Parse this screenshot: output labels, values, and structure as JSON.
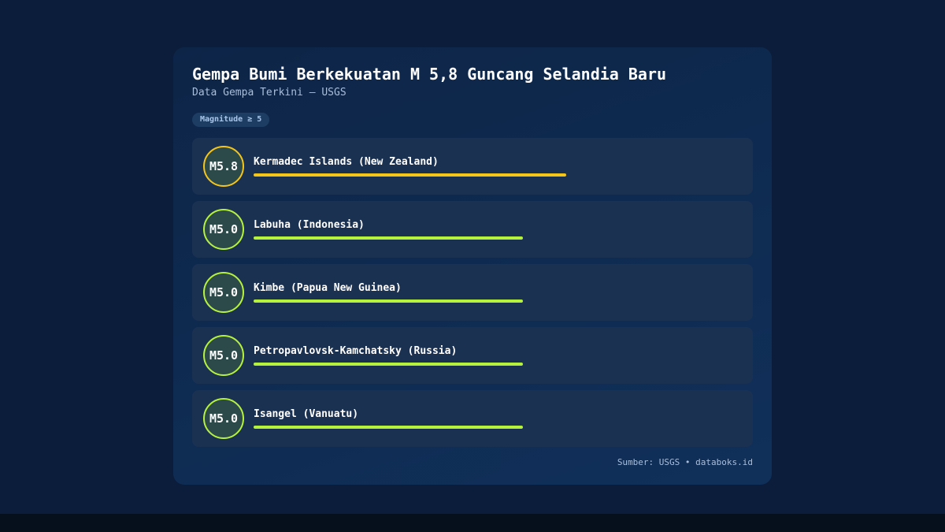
{
  "title": "Gempa Bumi Berkekuatan M 5,8 Guncang Selandia Baru",
  "subtitle": "Data Gempa Terkini — USGS",
  "badge": "Magnitude ≥ 5",
  "source": "Sumber: USGS • databoks.id",
  "colors": {
    "strong": "#f5c518",
    "moderate": "#b6f23c",
    "background": "#0b1d3a",
    "card": "#10305a"
  },
  "chart_data": {
    "type": "bar",
    "title": "Gempa Bumi Berkekuatan M 5,8 Guncang Selandia Baru",
    "subtitle": "Data Gempa Terkini — USGS",
    "categories": [
      "Kermadec Islands (New Zealand)",
      "Labuha (Indonesia)",
      "Kimbe (Papua New Guinea)",
      "Petropavlovsk-Kamchatsky (Russia)",
      "Isangel (Vanuatu)"
    ],
    "values": [
      5.8,
      5.0,
      5.0,
      5.0,
      5.0
    ],
    "value_labels": [
      "M5.8",
      "M5.0",
      "M5.0",
      "M5.0",
      "M5.0"
    ],
    "xlim": [
      0,
      8.3
    ],
    "orientation": "horizontal"
  }
}
